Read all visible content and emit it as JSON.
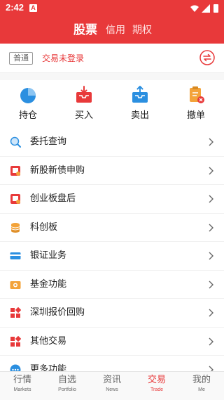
{
  "status_bar": {
    "time": "2:42",
    "notification_letter": "A"
  },
  "header": {
    "tabs": [
      {
        "label": "股票",
        "active": true
      },
      {
        "label": "信用",
        "active": false
      },
      {
        "label": "期权",
        "active": false
      }
    ]
  },
  "login_bar": {
    "account_type": "普通",
    "status_text": "交易未登录",
    "switch_icon": "swap-icon"
  },
  "quick_actions": [
    {
      "label": "持仓",
      "icon": "pie-chart-icon"
    },
    {
      "label": "买入",
      "icon": "inbox-download-icon"
    },
    {
      "label": "卖出",
      "icon": "inbox-upload-icon"
    },
    {
      "label": "撤单",
      "icon": "cancel-order-icon"
    }
  ],
  "menu": [
    {
      "label": "委托查询",
      "icon": "search-icon"
    },
    {
      "label": "新股新债申购",
      "icon": "new-share-icon"
    },
    {
      "label": "创业板盘后",
      "icon": "gem-board-icon"
    },
    {
      "label": "科创板",
      "icon": "coin-stack-icon"
    },
    {
      "label": "银证业务",
      "icon": "bank-card-icon"
    },
    {
      "label": "基金功能",
      "icon": "fund-icon"
    },
    {
      "label": "深圳报价回购",
      "icon": "grid-icon"
    },
    {
      "label": "其他交易",
      "icon": "grid-icon"
    },
    {
      "label": "更多功能",
      "icon": "more-icon"
    }
  ],
  "bottom_nav": [
    {
      "zh": "行情",
      "en": "Markets",
      "active": false
    },
    {
      "zh": "自选",
      "en": "Portfolio",
      "active": false
    },
    {
      "zh": "资讯",
      "en": "News",
      "active": false
    },
    {
      "zh": "交易",
      "en": "Trade",
      "active": true
    },
    {
      "zh": "我的",
      "en": "Me",
      "active": false
    }
  ],
  "colors": {
    "brand": "#e8393a",
    "blue": "#2b8fe0",
    "orange": "#f3a33a",
    "red": "#e8393a"
  }
}
